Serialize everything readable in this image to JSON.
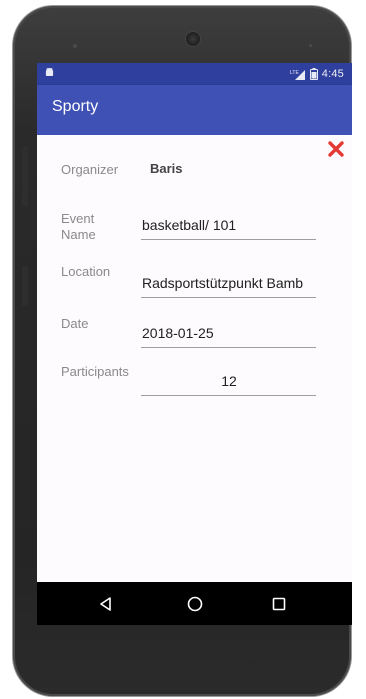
{
  "status_bar": {
    "time": "4:45",
    "network_label": "LTE",
    "left_icon": "android-debug-icon",
    "signal_icon": "signal-icon",
    "battery_icon": "battery-icon",
    "bg_color": "#2f3f9e"
  },
  "app_bar": {
    "title": "Sporty",
    "color": "#3f51b5"
  },
  "close_button": {
    "icon": "close-icon",
    "color": "#e53935"
  },
  "form": {
    "organizer": {
      "label": "Organizer",
      "value": "Baris"
    },
    "event_name": {
      "label": "Event\nName",
      "value": "basketball/ 101"
    },
    "location": {
      "label": "Location",
      "value": "Radsportstützpunkt Bamb"
    },
    "date": {
      "label": "Date",
      "value": "2018-01-25"
    },
    "participants": {
      "label": "Participants",
      "value": "12"
    }
  },
  "nav_bar": {
    "back_icon": "back-triangle-icon",
    "home_icon": "home-circle-icon",
    "recents_icon": "recents-square-icon"
  }
}
